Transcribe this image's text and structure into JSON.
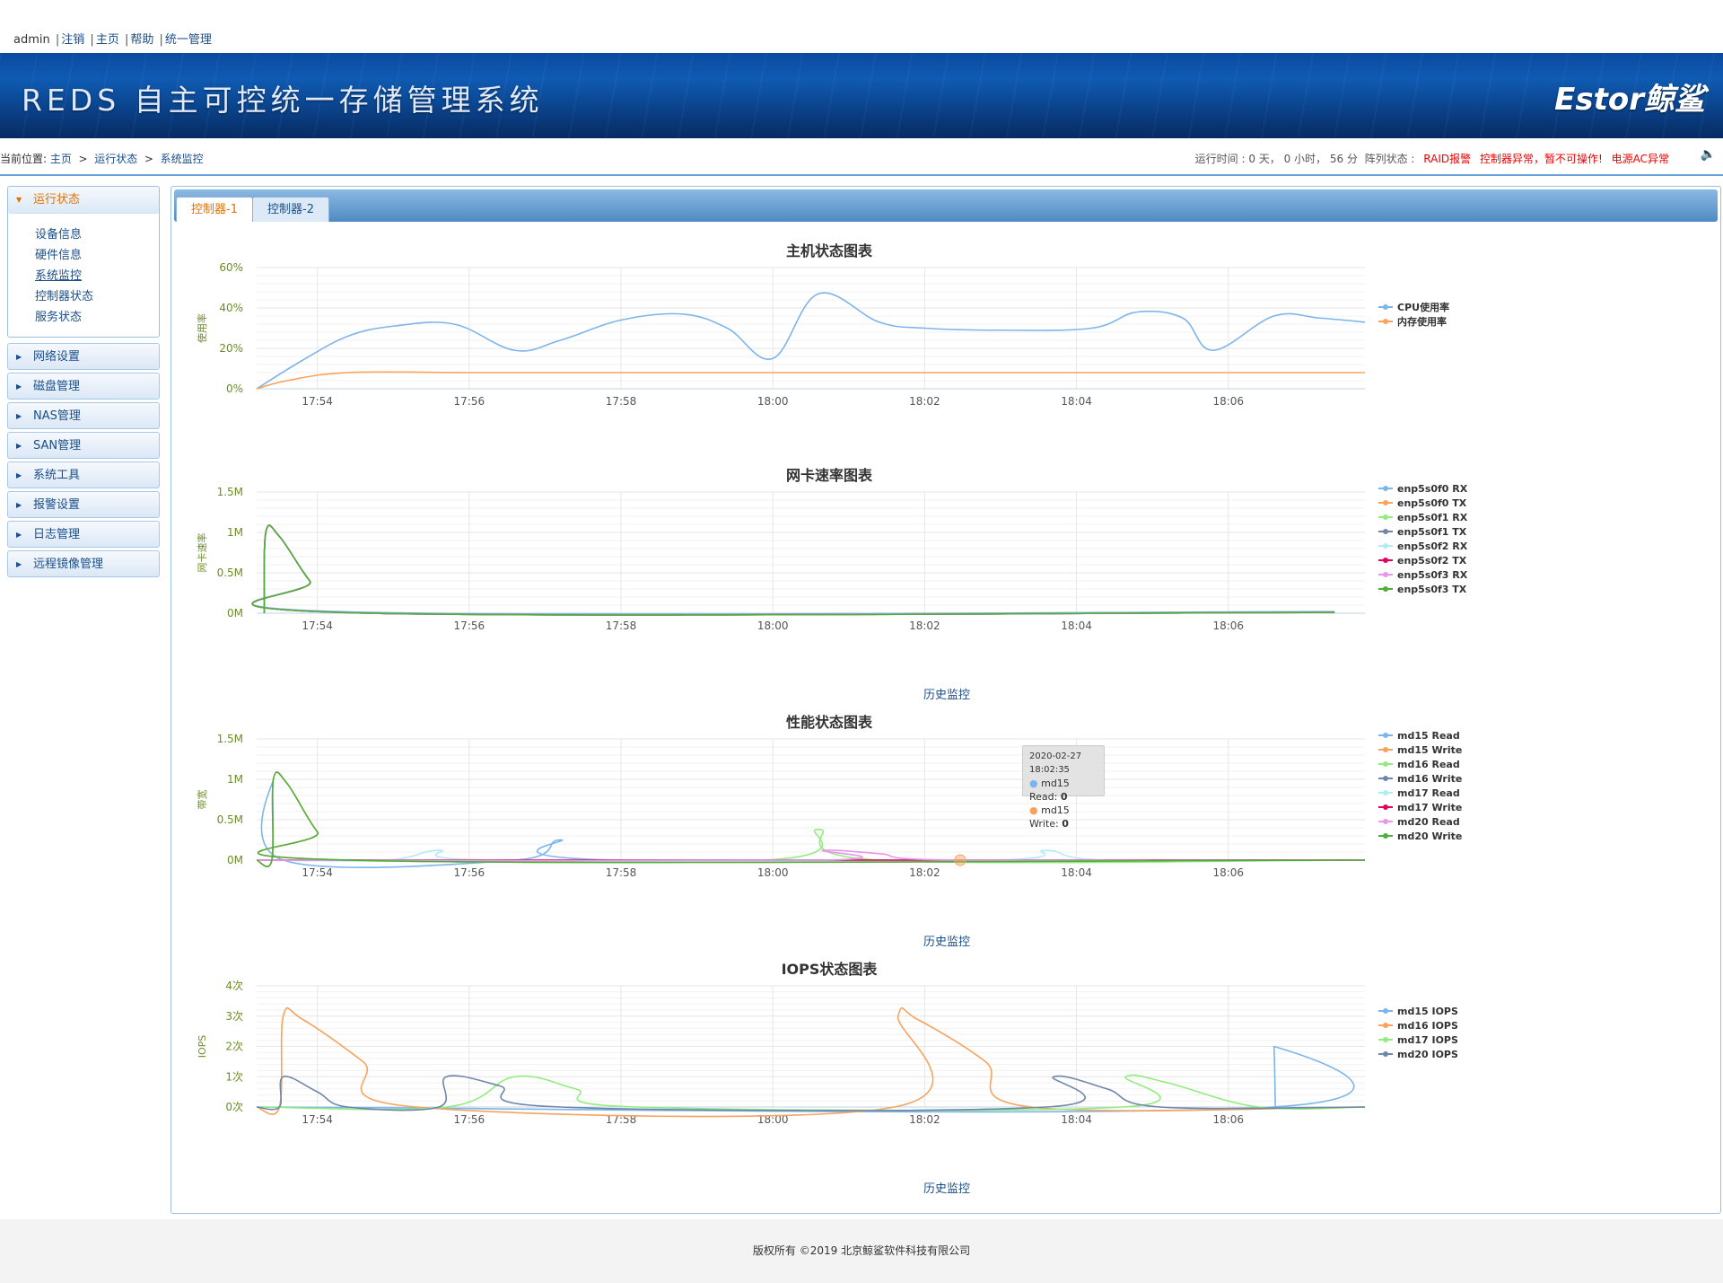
{
  "topbar": {
    "user": "admin",
    "links": [
      "注销",
      "主页",
      "帮助",
      "统一管理"
    ]
  },
  "banner": {
    "title": "REDS 自主可控统一存储管理系统",
    "logo": "Estor鲸鲨"
  },
  "location": {
    "prefix": "当前位置:",
    "crumbs": [
      "主页",
      "运行状态",
      "系统监控"
    ],
    "sep": ">",
    "runtime": "运行时间 : 0 天， 0 小时， 56 分",
    "array_label": "阵列状态 :",
    "alerts": [
      "RAID报警",
      "控制器异常，暂不可操作!",
      "电源AC异常"
    ]
  },
  "sidebar": {
    "open": {
      "label": "运行状态",
      "items": [
        "设备信息",
        "硬件信息",
        "系统监控",
        "控制器状态",
        "服务状态"
      ],
      "current": "系统监控"
    },
    "menus": [
      "网络设置",
      "磁盘管理",
      "NAS管理",
      "SAN管理",
      "系统工具",
      "报警设置",
      "日志管理",
      "远程镜像管理"
    ]
  },
  "tabs": [
    "控制器-1",
    "控制器-2"
  ],
  "history_label": "历史监控",
  "tooltip": {
    "time": "2020-02-27 18:02:35",
    "rows": [
      {
        "name": "md15 Read",
        "value": "0",
        "color": "#7cb5ec"
      },
      {
        "name": "md15 Write",
        "value": "0",
        "color": "#f7a35c"
      }
    ]
  },
  "footer": "版权所有 ©2019 北京鲸鲨软件科技有限公司",
  "chart_data": [
    {
      "type": "line",
      "title": "主机状态图表",
      "ylabel": "使用率",
      "yticks": [
        "0%",
        "20%",
        "40%",
        "60%"
      ],
      "ylim": [
        0,
        60
      ],
      "xticks": [
        "17:54",
        "17:56",
        "17:58",
        "18:00",
        "18:02",
        "18:04",
        "18:06"
      ],
      "xrange_min": [
        53.2,
        67.8
      ],
      "series": [
        {
          "name": "CPU使用率",
          "color": "#7cb5ec",
          "points": [
            [
              53.2,
              0
            ],
            [
              53.8,
              14
            ],
            [
              54.4,
              26
            ],
            [
              55.0,
              31
            ],
            [
              55.8,
              32
            ],
            [
              56.6,
              19
            ],
            [
              57.2,
              24
            ],
            [
              58.0,
              34
            ],
            [
              58.8,
              37
            ],
            [
              59.4,
              30
            ],
            [
              60.0,
              15
            ],
            [
              60.6,
              47
            ],
            [
              61.4,
              33
            ],
            [
              62.0,
              30
            ],
            [
              63.0,
              29
            ],
            [
              64.2,
              30
            ],
            [
              64.8,
              38
            ],
            [
              65.4,
              35
            ],
            [
              65.8,
              19
            ],
            [
              66.6,
              36
            ],
            [
              67.2,
              35
            ],
            [
              67.8,
              33
            ]
          ]
        },
        {
          "name": "内存使用率",
          "color": "#f7a35c",
          "points": [
            [
              53.2,
              0
            ],
            [
              53.6,
              4
            ],
            [
              54.4,
              8
            ],
            [
              56.0,
              8
            ],
            [
              58.0,
              8
            ],
            [
              60.0,
              8
            ],
            [
              62.0,
              8
            ],
            [
              64.0,
              8
            ],
            [
              66.0,
              8
            ],
            [
              67.8,
              8
            ]
          ]
        }
      ]
    },
    {
      "type": "line",
      "title": "网卡速率图表",
      "ylabel": "网卡速率",
      "yticks": [
        "0M",
        "0.5M",
        "1M",
        "1.5M"
      ],
      "ylim": [
        0,
        1.5
      ],
      "xticks": [
        "17:54",
        "17:56",
        "17:58",
        "18:00",
        "18:02",
        "18:04",
        "18:06"
      ],
      "xrange_min": [
        53.2,
        67.8
      ],
      "series": [
        {
          "name": "enp5s0f0 RX",
          "color": "#7cb5ec",
          "points": [
            [
              53.3,
              0
            ],
            [
              53.32,
              1.0
            ],
            [
              53.5,
              0.95
            ],
            [
              53.9,
              0.4
            ],
            [
              54.3,
              0.02
            ],
            [
              67.4,
              0.02
            ]
          ]
        },
        {
          "name": "enp5s0f0 TX",
          "color": "#f7a35c",
          "points": [
            [
              53.3,
              0
            ],
            [
              53.32,
              1.0
            ],
            [
              53.5,
              0.95
            ],
            [
              53.9,
              0.4
            ],
            [
              54.3,
              0.01
            ],
            [
              67.4,
              0.01
            ]
          ]
        },
        {
          "name": "enp5s0f1 RX",
          "color": "#90ed7d",
          "points": [
            [
              53.3,
              0
            ],
            [
              53.32,
              1.0
            ],
            [
              53.5,
              0.95
            ],
            [
              53.9,
              0.4
            ],
            [
              54.3,
              0.01
            ],
            [
              67.4,
              0.01
            ]
          ]
        },
        {
          "name": "enp5s0f1 TX",
          "color": "#6f86a8",
          "points": [
            [
              53.3,
              0
            ],
            [
              53.32,
              1.0
            ],
            [
              53.5,
              0.95
            ],
            [
              53.9,
              0.4
            ],
            [
              54.3,
              0.01
            ],
            [
              67.4,
              0.01
            ]
          ]
        },
        {
          "name": "enp5s0f2 RX",
          "color": "#b0ecf3",
          "points": [
            [
              53.3,
              0
            ],
            [
              53.32,
              1.0
            ],
            [
              53.5,
              0.95
            ],
            [
              53.9,
              0.4
            ],
            [
              54.3,
              0.01
            ],
            [
              67.4,
              0.01
            ]
          ]
        },
        {
          "name": "enp5s0f2 TX",
          "color": "#e4005e",
          "points": [
            [
              53.3,
              0
            ],
            [
              53.32,
              1.0
            ],
            [
              53.5,
              0.95
            ],
            [
              53.9,
              0.4
            ],
            [
              54.3,
              0.01
            ],
            [
              67.4,
              0.01
            ]
          ]
        },
        {
          "name": "enp5s0f3 RX",
          "color": "#e797e8",
          "points": [
            [
              53.3,
              0
            ],
            [
              53.32,
              1.0
            ],
            [
              53.5,
              0.95
            ],
            [
              53.9,
              0.4
            ],
            [
              54.3,
              0.01
            ],
            [
              67.4,
              0.01
            ]
          ]
        },
        {
          "name": "enp5s0f3 TX",
          "color": "#4fae3a",
          "points": [
            [
              53.3,
              0
            ],
            [
              53.32,
              1.0
            ],
            [
              53.5,
              0.95
            ],
            [
              53.9,
              0.4
            ],
            [
              54.3,
              0.01
            ],
            [
              67.4,
              0.01
            ]
          ]
        }
      ]
    },
    {
      "type": "line",
      "title": "性能状态图表",
      "ylabel": "带宽",
      "yticks": [
        "0M",
        "0.5M",
        "1M",
        "1.5M"
      ],
      "ylim": [
        0,
        1.5
      ],
      "xticks": [
        "17:54",
        "17:56",
        "17:58",
        "18:00",
        "18:02",
        "18:04",
        "18:06"
      ],
      "xrange_min": [
        53.2,
        67.8
      ],
      "series": [
        {
          "name": "md15 Read",
          "color": "#7cb5ec",
          "points": [
            [
              53.2,
              0
            ],
            [
              53.4,
              0
            ],
            [
              53.42,
              1.0
            ],
            [
              53.55,
              0
            ],
            [
              56.6,
              0
            ],
            [
              57.2,
              0.25
            ],
            [
              57.9,
              0
            ],
            [
              67.8,
              0
            ]
          ]
        },
        {
          "name": "md15 Write",
          "color": "#f7a35c",
          "points": [
            [
              53.2,
              0
            ],
            [
              53.4,
              0
            ],
            [
              53.42,
              1.0
            ],
            [
              53.6,
              0.95
            ],
            [
              54.0,
              0.35
            ],
            [
              54.4,
              0
            ],
            [
              67.8,
              0
            ]
          ]
        },
        {
          "name": "md16 Read",
          "color": "#90ed7d",
          "points": [
            [
              53.2,
              0
            ],
            [
              59.9,
              0
            ],
            [
              60.6,
              0.38
            ],
            [
              61.4,
              0
            ],
            [
              67.8,
              0
            ]
          ]
        },
        {
          "name": "md16 Write",
          "color": "#6f86a8",
          "points": [
            [
              53.2,
              0
            ],
            [
              67.8,
              0
            ]
          ]
        },
        {
          "name": "md17 Read",
          "color": "#b0ecf3",
          "points": [
            [
              53.2,
              0
            ],
            [
              54.9,
              0
            ],
            [
              55.6,
              0.12
            ],
            [
              56.3,
              0
            ],
            [
              62.8,
              0
            ],
            [
              63.6,
              0.12
            ],
            [
              64.4,
              0
            ],
            [
              67.8,
              0
            ]
          ]
        },
        {
          "name": "md17 Write",
          "color": "#e4005e",
          "points": [
            [
              53.2,
              0
            ],
            [
              67.8,
              0
            ]
          ]
        },
        {
          "name": "md20 Read",
          "color": "#e797e8",
          "points": [
            [
              53.2,
              0
            ],
            [
              60.6,
              0
            ],
            [
              60.66,
              0.12
            ],
            [
              61.4,
              0.08
            ],
            [
              62.4,
              0
            ],
            [
              67.8,
              0
            ]
          ]
        },
        {
          "name": "md20 Write",
          "color": "#4fae3a",
          "points": [
            [
              53.2,
              0
            ],
            [
              53.4,
              0
            ],
            [
              53.42,
              1.0
            ],
            [
              53.6,
              0.95
            ],
            [
              54.0,
              0.35
            ],
            [
              54.4,
              0
            ],
            [
              67.8,
              0
            ]
          ]
        }
      ]
    },
    {
      "type": "line",
      "title": "IOPS状态图表",
      "ylabel": "IOPS",
      "yticks": [
        "0次",
        "1次",
        "2次",
        "3次",
        "4次"
      ],
      "ylim": [
        0,
        4
      ],
      "xticks": [
        "17:54",
        "17:56",
        "17:58",
        "18:00",
        "18:02",
        "18:04",
        "18:06"
      ],
      "xrange_min": [
        53.2,
        67.8
      ],
      "series": [
        {
          "name": "md15 IOPS",
          "color": "#7cb5ec",
          "points": [
            [
              53.2,
              0
            ],
            [
              66.58,
              0
            ],
            [
              66.6,
              2
            ],
            [
              66.62,
              0
            ]
          ]
        },
        {
          "name": "md16 IOPS",
          "color": "#f7a35c",
          "points": [
            [
              53.2,
              0
            ],
            [
              53.5,
              0
            ],
            [
              53.55,
              3
            ],
            [
              53.8,
              2.9
            ],
            [
              54.6,
              1.5
            ],
            [
              55.3,
              0
            ],
            [
              61.6,
              0
            ],
            [
              61.65,
              3
            ],
            [
              61.9,
              2.9
            ],
            [
              62.8,
              1.5
            ],
            [
              63.4,
              0
            ],
            [
              67.8,
              0
            ]
          ]
        },
        {
          "name": "md17 IOPS",
          "color": "#90ed7d",
          "points": [
            [
              53.2,
              0
            ],
            [
              55.7,
              0
            ],
            [
              56.6,
              1
            ],
            [
              57.4,
              0.6
            ],
            [
              58.2,
              0
            ],
            [
              64.6,
              0
            ],
            [
              64.65,
              1
            ],
            [
              65.2,
              0.8
            ],
            [
              66.4,
              0
            ],
            [
              67.8,
              0
            ]
          ]
        },
        {
          "name": "md20 IOPS",
          "color": "#6f86a8",
          "points": [
            [
              53.2,
              0
            ],
            [
              53.5,
              0
            ],
            [
              53.55,
              1
            ],
            [
              54.0,
              0.5
            ],
            [
              54.4,
              0
            ],
            [
              55.6,
              0
            ],
            [
              55.7,
              1
            ],
            [
              56.4,
              0.7
            ],
            [
              57.2,
              0
            ],
            [
              63.6,
              0
            ],
            [
              63.7,
              1
            ],
            [
              64.4,
              0.6
            ],
            [
              65.1,
              0
            ],
            [
              67.8,
              0
            ]
          ]
        }
      ]
    }
  ]
}
